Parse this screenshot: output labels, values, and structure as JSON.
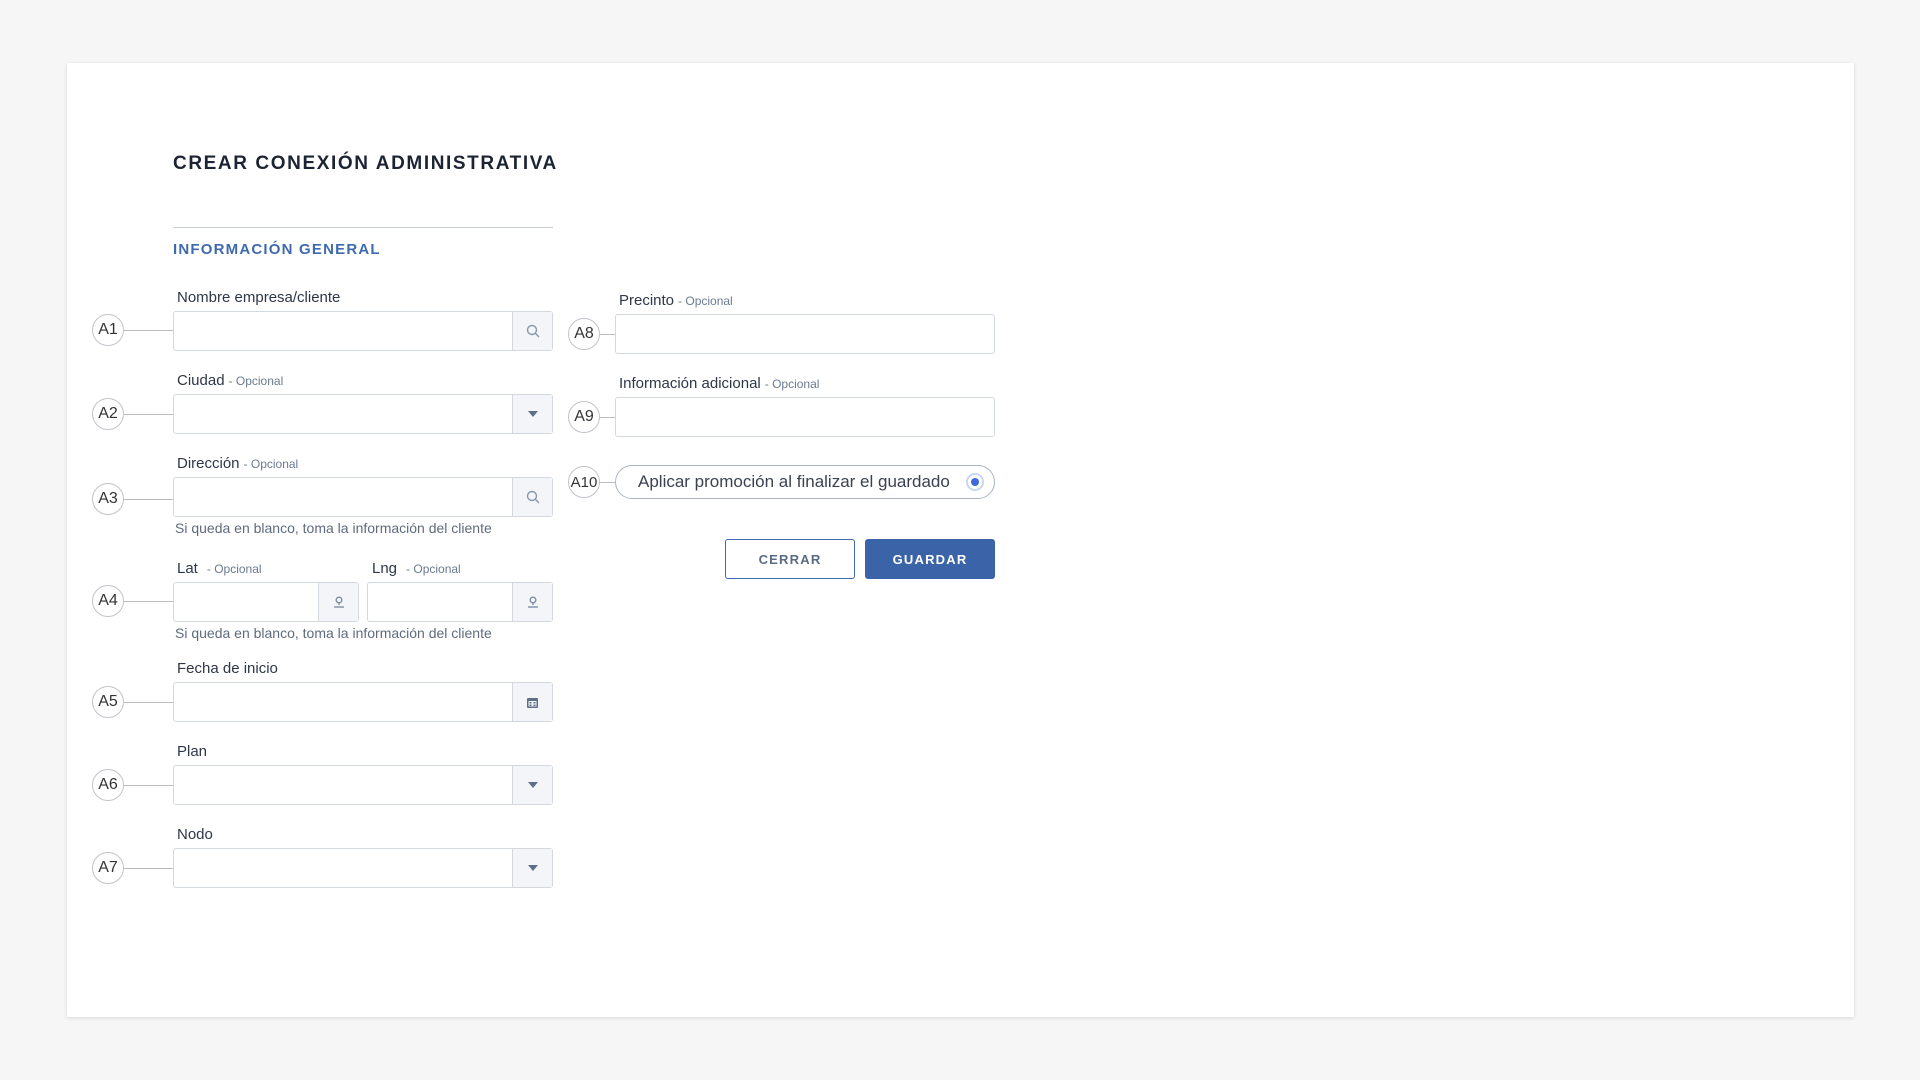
{
  "page": {
    "title": "CREAR CONEXIÓN ADMINISTRATIVA"
  },
  "section": {
    "title": "INFORMACIÓN GENERAL"
  },
  "optional_tag": "- Opcional",
  "fields": {
    "empresa": {
      "marker": "A1",
      "label": "Nombre empresa/cliente",
      "value": "",
      "icon": "search-icon"
    },
    "ciudad": {
      "marker": "A2",
      "label": "Ciudad",
      "optional": "- Opcional",
      "value": "",
      "icon": "chevron-down-icon"
    },
    "direccion": {
      "marker": "A3",
      "label": "Dirección",
      "optional": "- Opcional",
      "value": "",
      "icon": "search-icon",
      "hint": "Si queda en blanco, toma la información del cliente"
    },
    "coords": {
      "marker": "A4",
      "lat_label": "Lat",
      "lat_optional": "- Opcional",
      "lng_label": "Lng",
      "lng_optional": "- Opcional",
      "icon": "location-pin-icon",
      "hint": "Si queda en blanco, toma la información del cliente"
    },
    "fecha": {
      "marker": "A5",
      "label": "Fecha de inicio",
      "value": "",
      "icon": "calendar-icon"
    },
    "plan": {
      "marker": "A6",
      "label": "Plan",
      "value": "",
      "icon": "chevron-down-icon"
    },
    "nodo": {
      "marker": "A7",
      "label": "Nodo",
      "value": "",
      "icon": "chevron-down-icon"
    },
    "precinto": {
      "marker": "A8",
      "label": "Precinto",
      "optional": "- Opcional",
      "value": ""
    },
    "info_adicional": {
      "marker": "A9",
      "label": "Información adicional",
      "optional": "- Opcional",
      "value": ""
    },
    "promocion": {
      "marker": "A10",
      "label": "Aplicar promoción al finalizar el guardado",
      "selected": true
    }
  },
  "buttons": {
    "close": "CERRAR",
    "save": "GUARDAR"
  },
  "colors": {
    "accent": "#3f6aad",
    "primary_button": "#3b63a8",
    "background": "#f6f6f7"
  }
}
